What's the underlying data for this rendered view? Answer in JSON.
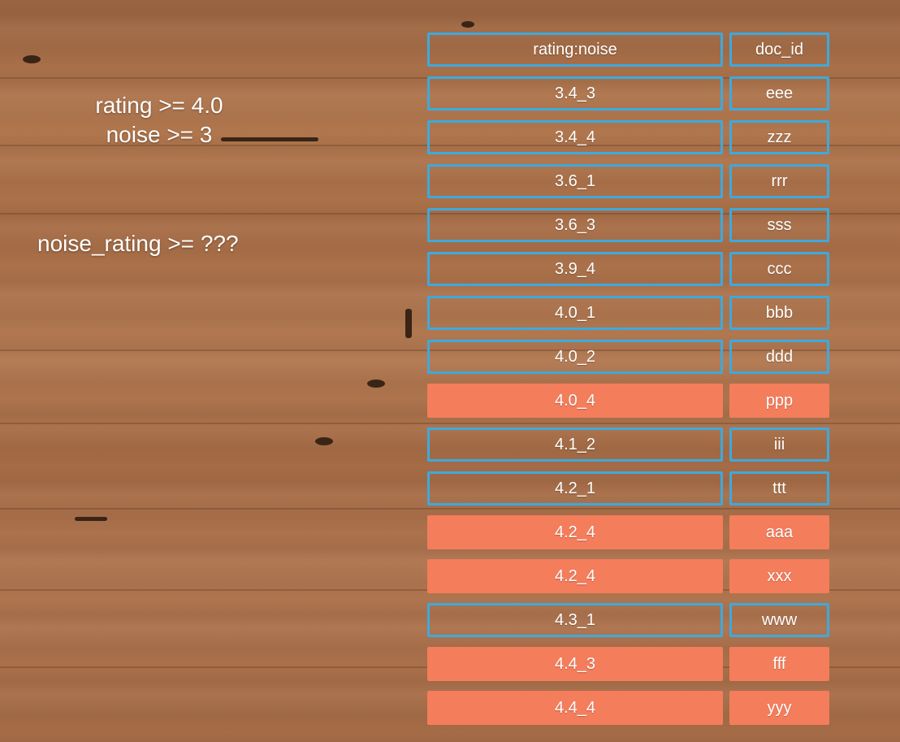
{
  "notes": {
    "line1": "rating >= 4.0",
    "line2": "noise >= 3",
    "line3": "noise_rating >= ???"
  },
  "table": {
    "header": {
      "key": "rating:noise",
      "id": "doc_id"
    },
    "rows": [
      {
        "key": "3.4_3",
        "id": "eee",
        "highlighted": false
      },
      {
        "key": "3.4_4",
        "id": "zzz",
        "highlighted": false
      },
      {
        "key": "3.6_1",
        "id": "rrr",
        "highlighted": false
      },
      {
        "key": "3.6_3",
        "id": "sss",
        "highlighted": false
      },
      {
        "key": "3.9_4",
        "id": "ccc",
        "highlighted": false
      },
      {
        "key": "4.0_1",
        "id": "bbb",
        "highlighted": false
      },
      {
        "key": "4.0_2",
        "id": "ddd",
        "highlighted": false
      },
      {
        "key": "4.0_4",
        "id": "ppp",
        "highlighted": true
      },
      {
        "key": "4.1_2",
        "id": "iii",
        "highlighted": false
      },
      {
        "key": "4.2_1",
        "id": "ttt",
        "highlighted": false
      },
      {
        "key": "4.2_4",
        "id": "aaa",
        "highlighted": true
      },
      {
        "key": "4.2_4",
        "id": "xxx",
        "highlighted": true
      },
      {
        "key": "4.3_1",
        "id": "www",
        "highlighted": false
      },
      {
        "key": "4.4_3",
        "id": "fff",
        "highlighted": true
      },
      {
        "key": "4.4_4",
        "id": "yyy",
        "highlighted": true
      }
    ]
  },
  "colors": {
    "border": "#3ea9dd",
    "highlight": "#f47d5c",
    "text": "#ffffff"
  }
}
